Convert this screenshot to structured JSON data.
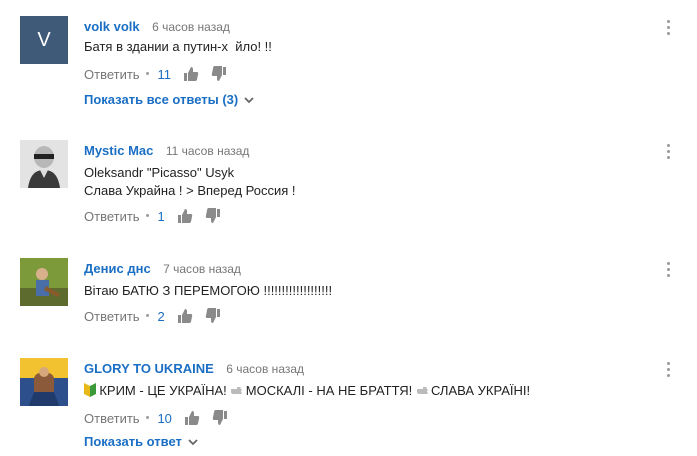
{
  "comments": [
    {
      "author": "volk volk",
      "time": "6 часов назад",
      "avatar_letter": "V",
      "lines": [
        "Батя в здании а путин-х  йло! !!"
      ],
      "reply_label": "Ответить",
      "likes": "11",
      "more_replies": "Показать все ответы (3)"
    },
    {
      "author": "Mystic Mac",
      "time": "11 часов назад",
      "lines": [
        "Oleksandr \"Picasso\" Usyk",
        "Слава Украйна ! > Вперед Россия !"
      ],
      "reply_label": "Ответить",
      "likes": "1"
    },
    {
      "author": "Денис днс",
      "time": "7 часов назад",
      "lines": [
        "Вітаю БАТЮ  З ПЕРЕМОГОЮ !!!!!!!!!!!!!!!!!!!"
      ],
      "reply_label": "Ответить",
      "likes": "2"
    },
    {
      "author": "GLORY TO UKRAINE",
      "time": "6 часов назад",
      "segments": [
        "КРИМ - ЦЕ УКРАЇНА!",
        " МОСКАЛІ - НА НЕ БРАТТЯ!",
        "СЛАВА УКРАЇНІ!"
      ],
      "reply_label": "Ответить",
      "likes": "10",
      "more_replies": "Показать ответ"
    }
  ],
  "icons": {
    "like": "thumbs-up-icon",
    "dislike": "thumbs-down-icon",
    "menu": "more-vert-icon",
    "chevron": "chevron-down-icon"
  },
  "colors": {
    "author": "#1a6fc4",
    "link": "#1a6fc4",
    "meta": "#767676",
    "avatar_v": "#3e5a78"
  }
}
